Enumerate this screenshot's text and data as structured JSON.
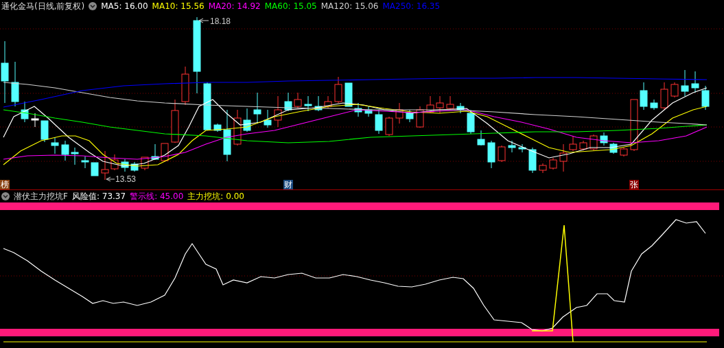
{
  "main_panel": {
    "title": "通化金马(日线,前复权)",
    "indicators": [
      {
        "label": "MA5: 16.00",
        "color": "#ffffff"
      },
      {
        "label": "MA10: 15.56",
        "color": "#ffff00"
      },
      {
        "label": "MA20: 14.92",
        "color": "#ff00ff"
      },
      {
        "label": "MA60: 15.05",
        "color": "#00ff00"
      },
      {
        "label": "MA120: 15.06",
        "color": "#d0d0d0"
      },
      {
        "label": "MA250: 16.35",
        "color": "#0000ff"
      }
    ],
    "high_label": "18.18",
    "low_label": "13.53",
    "markers": [
      {
        "text": "榜",
        "color": "#8b4513"
      },
      {
        "text": "财",
        "color": "#1a4a80"
      },
      {
        "text": "张",
        "color": "#8b0000"
      }
    ]
  },
  "sub_panel": {
    "title": "潜伏主力挖坑F",
    "values": [
      {
        "label": "风险值: 73.37",
        "color": "#ffffff"
      },
      {
        "label": "警示线: 45.00",
        "color": "#ff00ff"
      },
      {
        "label": "主力挖坑: 0.00",
        "color": "#ffff00"
      }
    ]
  }
}
